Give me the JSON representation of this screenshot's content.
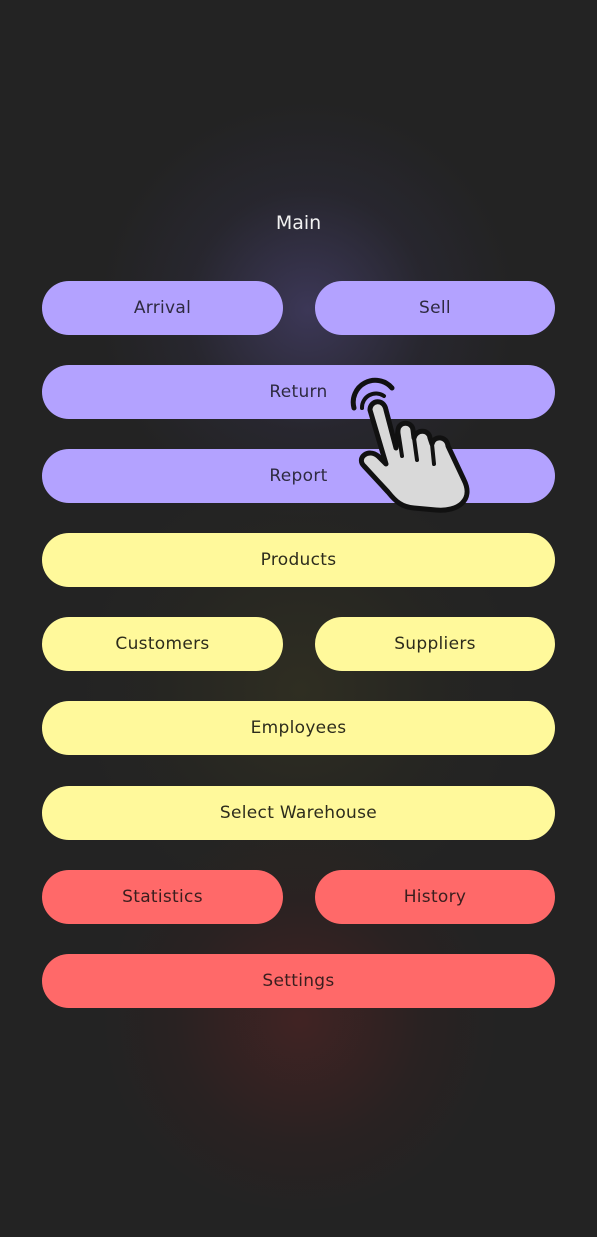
{
  "screen": {
    "title": "Main"
  },
  "buttons": {
    "arrival": "Arrival",
    "sell": "Sell",
    "return": "Return",
    "report": "Report",
    "products": "Products",
    "customers": "Customers",
    "suppliers": "Suppliers",
    "employees": "Employees",
    "select_warehouse": "Select Warehouse",
    "statistics": "Statistics",
    "history": "History",
    "settings": "Settings"
  },
  "colors": {
    "background": "#232323",
    "purple": "#b3a2ff",
    "yellow": "#fff99b",
    "red": "#ff6969"
  },
  "icons": {
    "pointer": "tap-hand-icon"
  }
}
